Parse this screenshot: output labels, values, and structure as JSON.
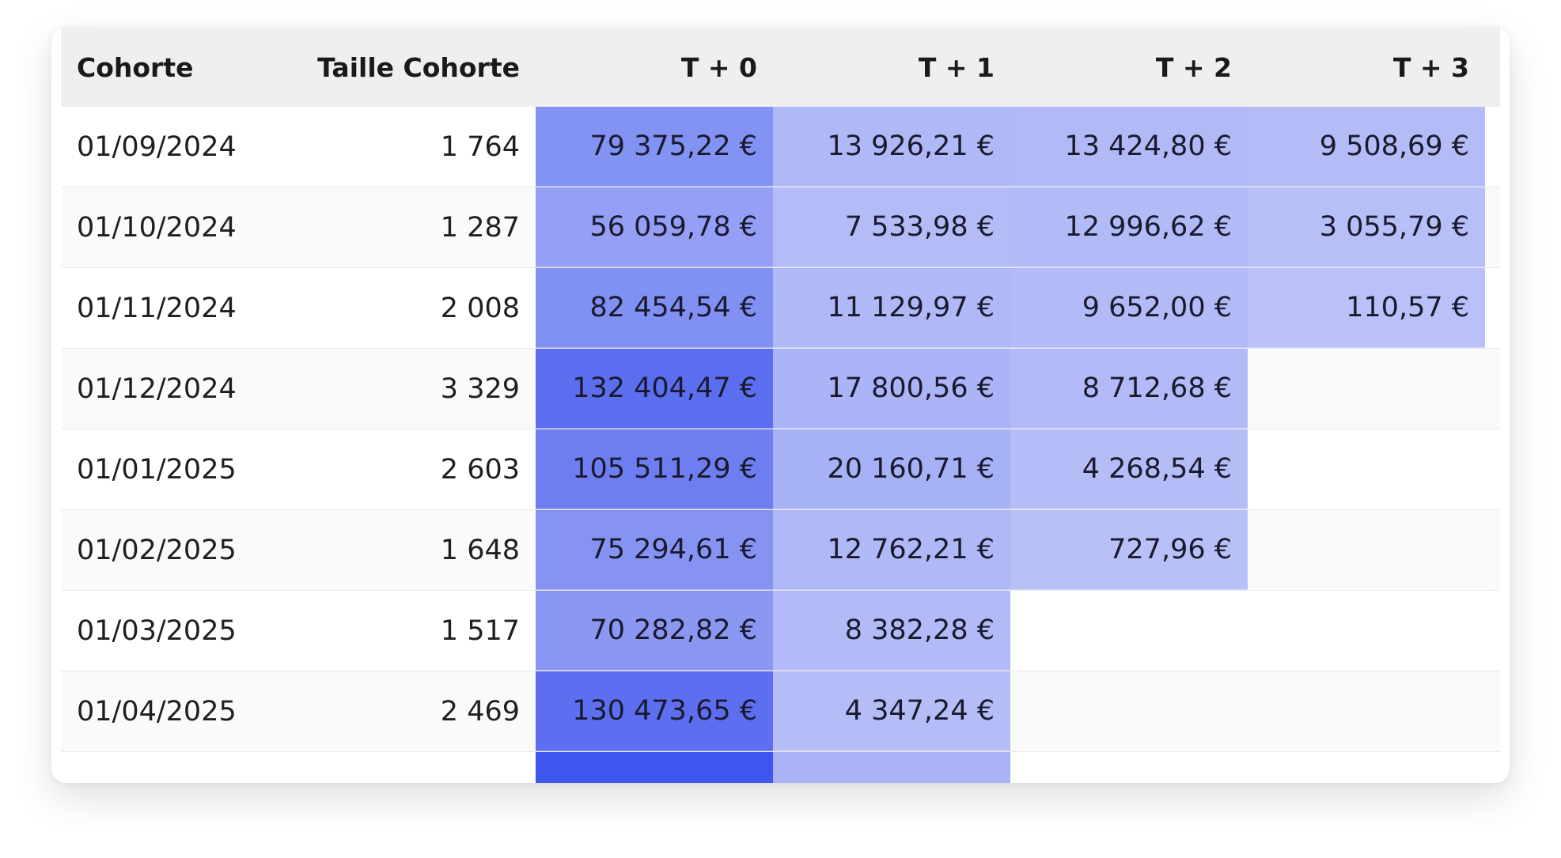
{
  "table": {
    "columns": [
      "Cohorte",
      "Taille Cohorte",
      "T + 0",
      "T + 1",
      "T + 2",
      "T + 3"
    ],
    "rows": [
      {
        "cohort": "01/09/2024",
        "size": "1 764",
        "values": [
          "79 375,22 €",
          "13 926,21 €",
          "13 424,80 €",
          "9 508,69 €"
        ]
      },
      {
        "cohort": "01/10/2024",
        "size": "1 287",
        "values": [
          "56 059,78 €",
          "7 533,98 €",
          "12 996,62 €",
          "3 055,79 €"
        ]
      },
      {
        "cohort": "01/11/2024",
        "size": "2 008",
        "values": [
          "82 454,54 €",
          "11 129,97 €",
          "9 652,00 €",
          "110,57 €"
        ]
      },
      {
        "cohort": "01/12/2024",
        "size": "3 329",
        "values": [
          "132 404,47 €",
          "17 800,56 €",
          "8 712,68 €",
          ""
        ]
      },
      {
        "cohort": "01/01/2025",
        "size": "2 603",
        "values": [
          "105 511,29 €",
          "20 160,71 €",
          "4 268,54 €",
          ""
        ]
      },
      {
        "cohort": "01/02/2025",
        "size": "1 648",
        "values": [
          "75 294,61 €",
          "12 762,21 €",
          "727,96 €",
          ""
        ]
      },
      {
        "cohort": "01/03/2025",
        "size": "1 517",
        "values": [
          "70 282,82 €",
          "8 382,28 €",
          "",
          ""
        ]
      },
      {
        "cohort": "01/04/2025",
        "size": "2 469",
        "values": [
          "130 473,65 €",
          "4 347,24 €",
          "",
          ""
        ]
      }
    ],
    "heat_colors": [
      [
        "#8293f3",
        "#afb9f7",
        "#b1baf7",
        "#b4bcf7"
      ],
      [
        "#949ff5",
        "#b3bcf7",
        "#b1bbf7",
        "#b7bff7"
      ],
      [
        "#8090f3",
        "#b0b9f7",
        "#b2bbf7",
        "#b9c1f8"
      ],
      [
        "#5b6ef0",
        "#aab4f6",
        "#b2bbf7",
        null
      ],
      [
        "#6e7ef1",
        "#a7b1f6",
        "#b5bdf7",
        null
      ],
      [
        "#8594f3",
        "#b0b9f7",
        "#b8c0f8",
        null
      ],
      [
        "#8a97f3",
        "#b2bbf7",
        null,
        null
      ],
      [
        "#5d6ff0",
        "#b5bdf7",
        null,
        null
      ]
    ],
    "partial_row_colors": [
      "#3f56ee",
      "#a9b3f6"
    ]
  }
}
